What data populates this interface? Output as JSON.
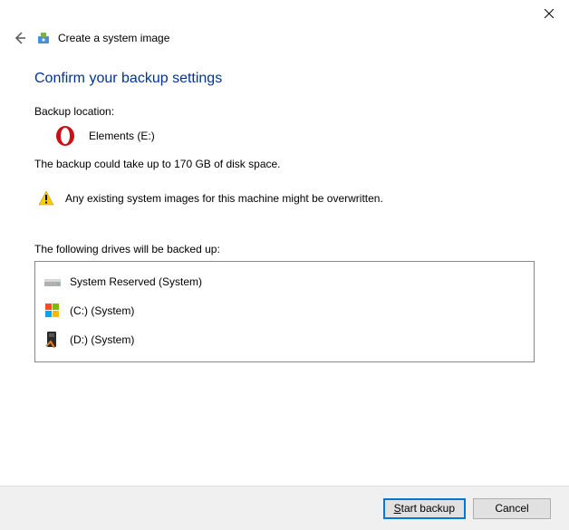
{
  "titlebar": {
    "close_label": "Close"
  },
  "header": {
    "back_label": "Back",
    "app_title": "Create a system image"
  },
  "main": {
    "heading": "Confirm your backup settings",
    "backup_location_label": "Backup location:",
    "backup_location_value": "Elements (E:)",
    "size_text": "The backup could take up to 170 GB of disk space.",
    "warning_text": "Any existing system images for this machine might be overwritten.",
    "drives_label": "The following drives will be backed up:",
    "drives": [
      {
        "name": "System Reserved (System)"
      },
      {
        "name": "(C:) (System)"
      },
      {
        "name": "(D:) (System)"
      }
    ]
  },
  "footer": {
    "start_accel": "S",
    "start_rest": "tart backup",
    "cancel_label": "Cancel"
  }
}
